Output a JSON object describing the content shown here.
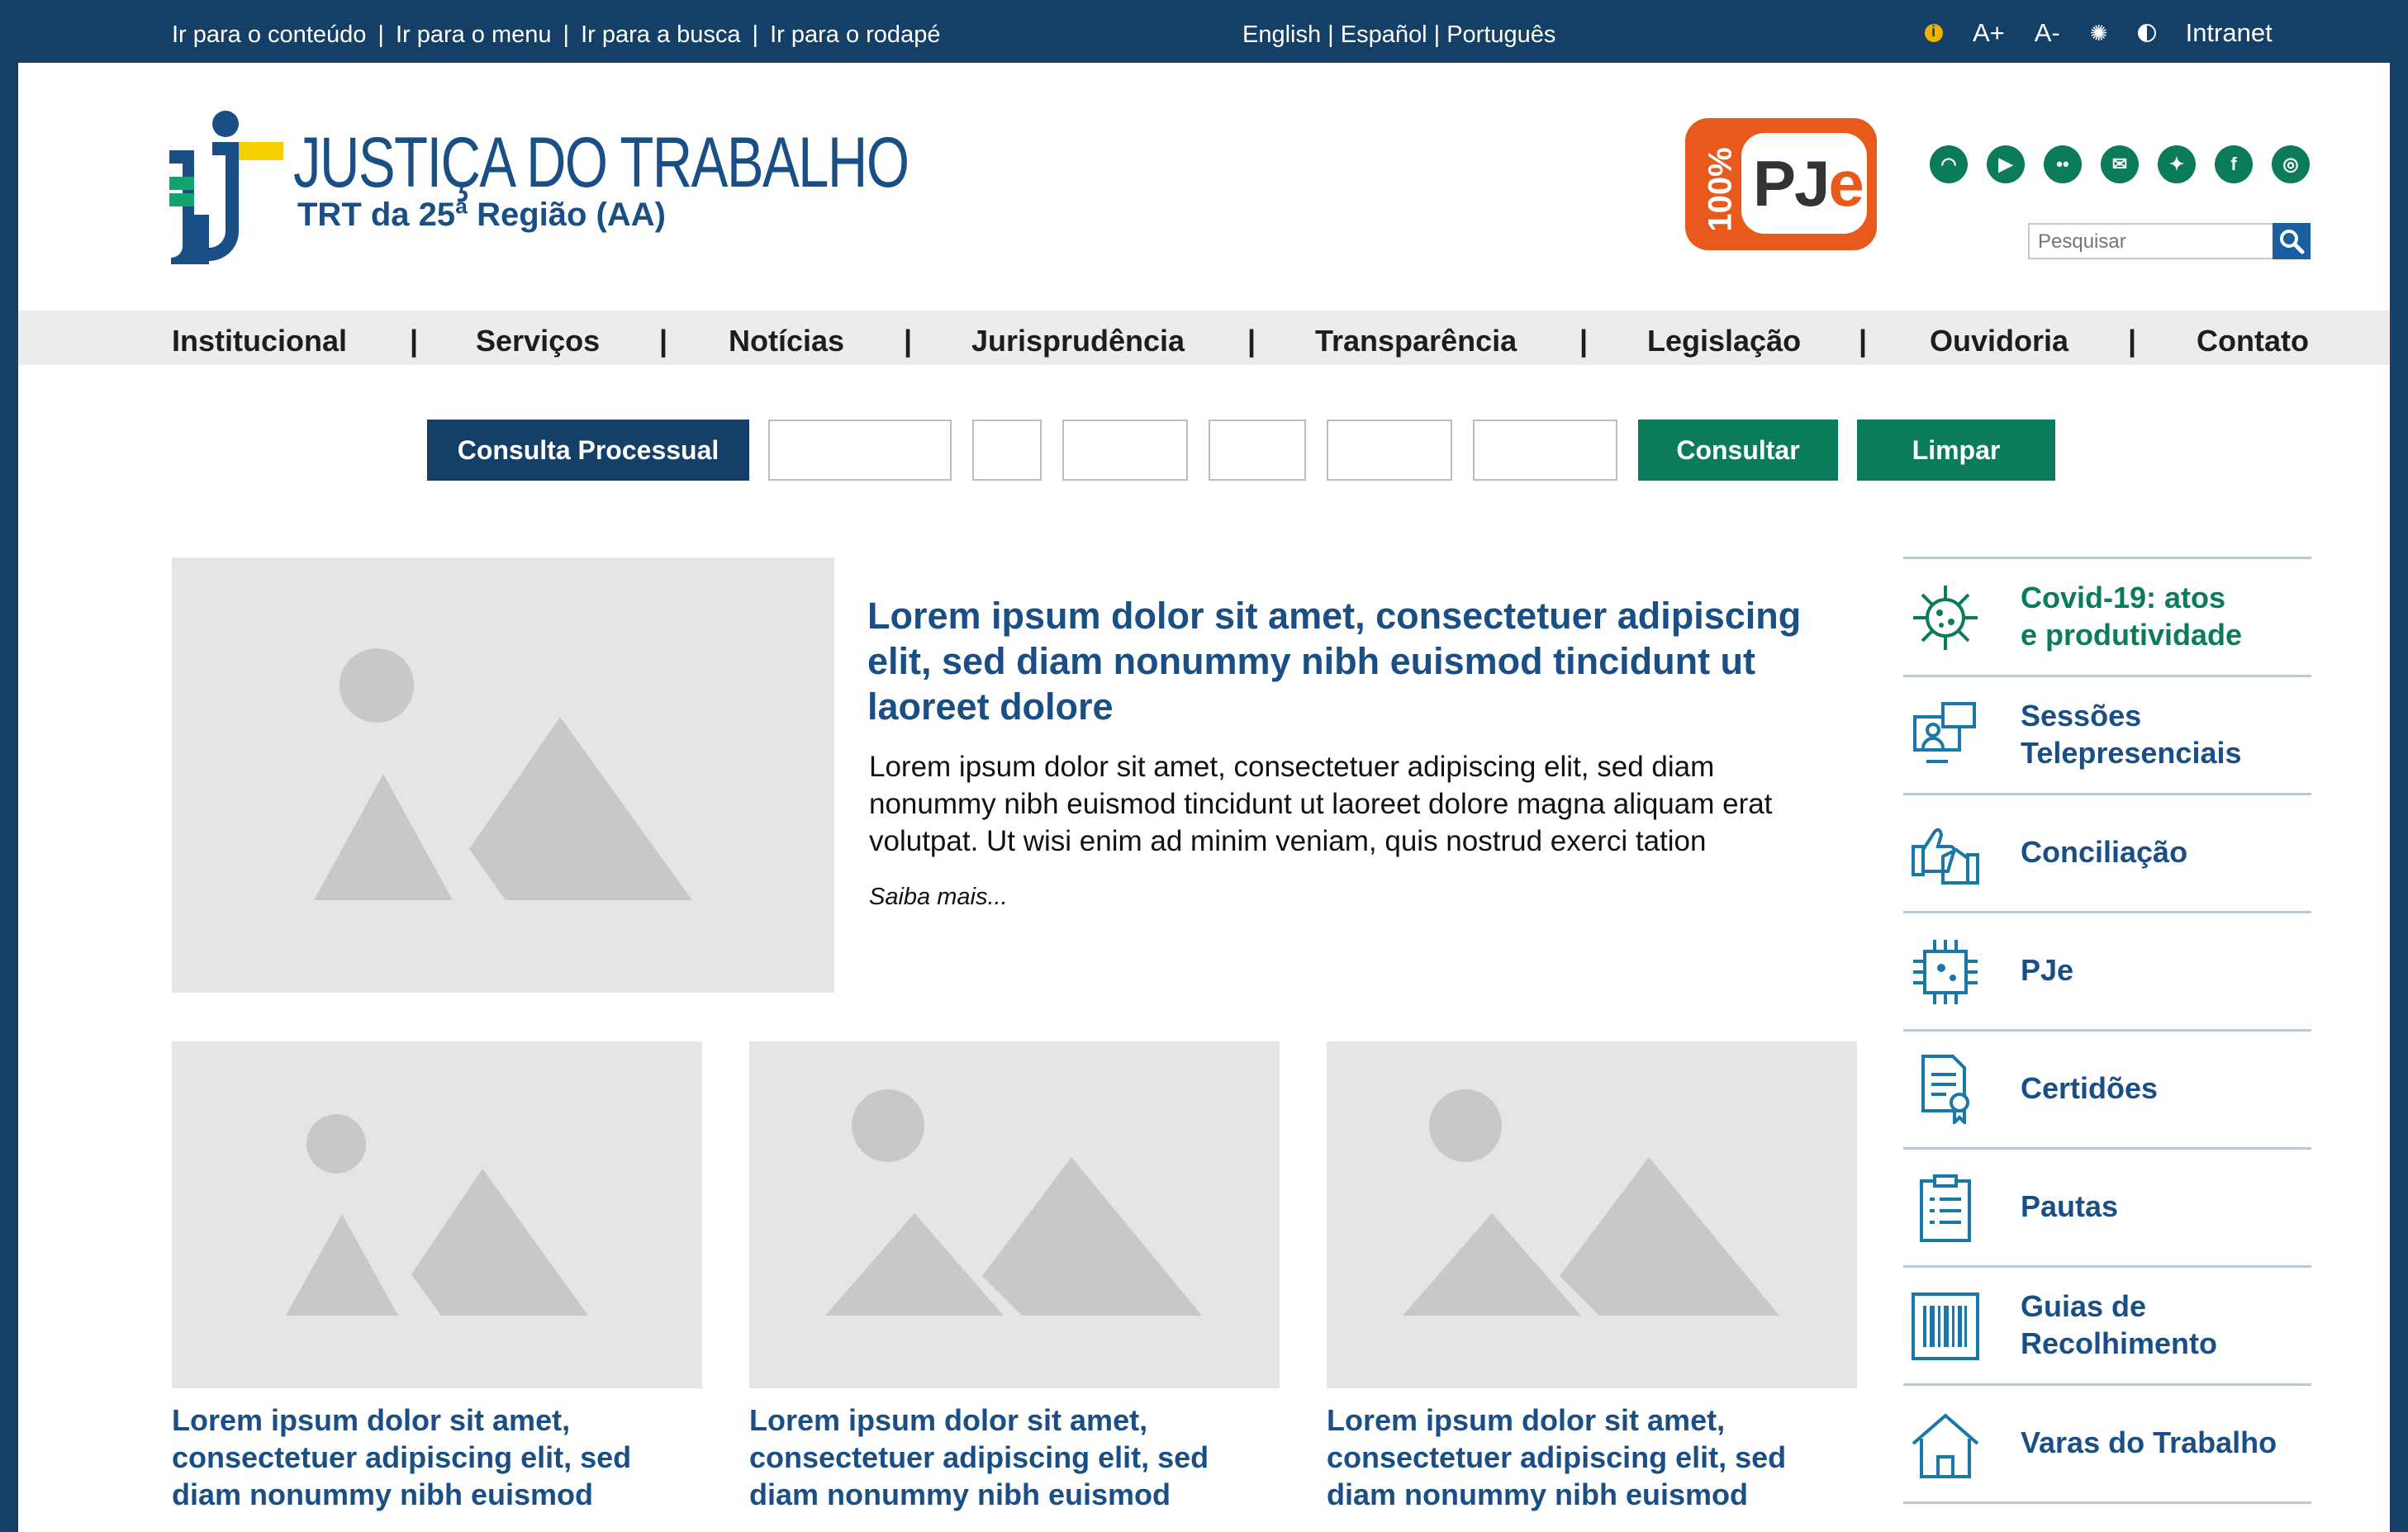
{
  "topbar": {
    "skip_links": [
      "Ir para o conteúdo",
      "Ir para o menu",
      "Ir para a busca",
      "Ir para o rodapé"
    ],
    "separator": "|",
    "languages": "English | Español | Português",
    "font_up": "A+",
    "font_down": "A-",
    "intranet": "Intranet"
  },
  "header": {
    "brand_title": "JUSTIÇA DO TRABALHO",
    "brand_subtitle": "TRT da 25ª Região (AA)",
    "pje_word_p": "PJ",
    "pje_word_e": "e",
    "pje_percent": "100%",
    "social_icons": [
      "rss-icon",
      "youtube-icon",
      "flickr-icon",
      "email-icon",
      "twitter-icon",
      "facebook-icon",
      "instagram-icon"
    ],
    "search_placeholder": "Pesquisar"
  },
  "nav": {
    "items": [
      "Institucional",
      "Serviços",
      "Notícias",
      "Jurisprudência",
      "Transparência",
      "Legislação",
      "Ouvidoria",
      "Contato"
    ],
    "separator": "|"
  },
  "process": {
    "label": "Consulta Processual",
    "consult_button": "Consultar",
    "clear_button": "Limpar"
  },
  "featured": {
    "title": "Lorem ipsum dolor sit amet, consectetuer adipiscing elit, sed diam nonummy nibh euismod tincidunt ut laoreet dolore",
    "text": "Lorem ipsum dolor sit amet, consectetuer adipiscing elit, sed diam nonummy nibh euismod tincidunt ut laoreet dolore magna aliquam erat volutpat. Ut wisi enim ad minim veniam, quis nostrud exerci tation",
    "more": "Saiba mais..."
  },
  "cards": [
    {
      "title": "Lorem ipsum dolor sit amet, consectetuer adipiscing elit, sed diam nonummy nibh euismod"
    },
    {
      "title": "Lorem ipsum dolor sit amet, consectetuer adipiscing elit, sed diam nonummy nibh euismod"
    },
    {
      "title": "Lorem ipsum dolor sit amet, consectetuer adipiscing elit, sed diam nonummy nibh euismod"
    }
  ],
  "side_menu": [
    {
      "line1": "Covid-19: atos",
      "line2": "e produtividade",
      "icon": "virus-icon"
    },
    {
      "line1": "Sessões",
      "line2": "Telepresenciais",
      "icon": "video-conference-icon"
    },
    {
      "line1": "Conciliação",
      "line2": "",
      "icon": "handshake-icon"
    },
    {
      "line1": "PJe",
      "line2": "",
      "icon": "chip-icon"
    },
    {
      "line1": "Certidões",
      "line2": "",
      "icon": "certificate-icon"
    },
    {
      "line1": "Pautas",
      "line2": "",
      "icon": "clipboard-icon"
    },
    {
      "line1": "Guias de",
      "line2": "Recolhimento",
      "icon": "barcode-icon"
    },
    {
      "line1": "Varas do Trabalho",
      "line2": "",
      "icon": "courthouse-icon"
    }
  ],
  "colors": {
    "navy": "#143f66",
    "brand_blue": "#1a4f86",
    "green": "#0b7b5b",
    "pje_orange": "#e85a1c",
    "placeholder_gray": "#e5e5e5"
  }
}
